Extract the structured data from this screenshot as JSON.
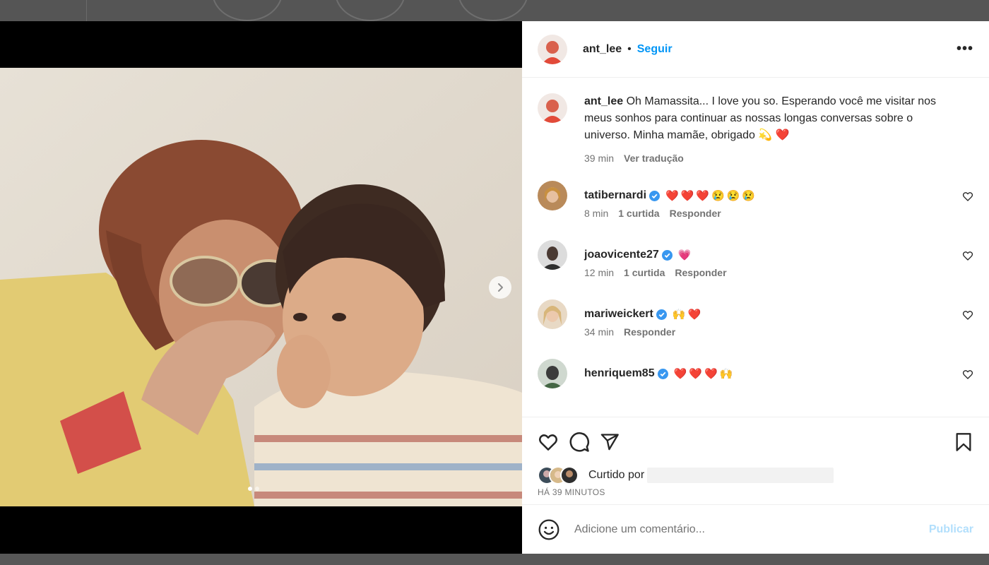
{
  "post": {
    "author": "ant_lee",
    "separator": "•",
    "follow_label": "Seguir",
    "more_label": "•••",
    "caption": "Oh Mamassita... I love you so. Esperando você me visitar nos meus sonhos para continuar as nossas longas conversas sobre o universo. Minha mamãe, obrigado 💫 ❤️",
    "caption_time": "39 min",
    "translate_label": "Ver tradução"
  },
  "comments": [
    {
      "user": "tatibernardi",
      "text": "❤️❤️❤️😢😢😢",
      "time": "8 min",
      "likes": "1 curtida",
      "reply": "Responder"
    },
    {
      "user": "joaovicente27",
      "text": "💗",
      "time": "12 min",
      "likes": "1 curtida",
      "reply": "Responder"
    },
    {
      "user": "mariweickert",
      "text": "🙌❤️",
      "time": "34 min",
      "likes": "",
      "reply": "Responder"
    },
    {
      "user": "henriquem85",
      "text": "❤️❤️❤️🙌",
      "time": "",
      "likes": "",
      "reply": ""
    }
  ],
  "likes": {
    "liked_by_label": "Curtido por",
    "timestamp": "HÁ 39 MINUTOS"
  },
  "composer": {
    "placeholder": "Adicione um comentário...",
    "publish_label": "Publicar"
  },
  "icons": {
    "like": "heart-icon",
    "comment": "comment-icon",
    "share": "share-icon",
    "save": "bookmark-icon",
    "emoji": "emoji-icon",
    "next": "chevron-right-icon"
  },
  "colors": {
    "accent": "#0095f6",
    "publish_disabled": "#b2dffc",
    "verified": "#3897f0",
    "secondary_text": "#737373"
  },
  "carousel": {
    "total": 2,
    "current": 1
  }
}
